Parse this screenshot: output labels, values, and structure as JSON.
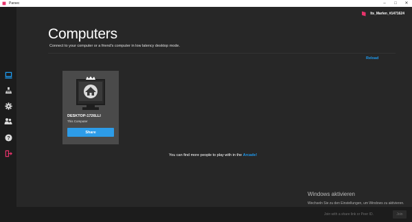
{
  "window": {
    "title": "Parsec"
  },
  "colors": {
    "accent": "#1e9bf0",
    "brand": "#e8336b",
    "sidebar": "#1c1c1c",
    "background": "#272727",
    "card": "#4a4a4a"
  },
  "sidebar": {
    "items": [
      {
        "icon": "computer-icon",
        "active": true
      },
      {
        "icon": "arcade-icon",
        "active": false
      },
      {
        "icon": "gear-icon",
        "active": false
      },
      {
        "icon": "friends-icon",
        "active": false
      },
      {
        "icon": "help-icon",
        "active": false
      },
      {
        "icon": "logout-icon",
        "active": false
      }
    ]
  },
  "header": {
    "username": "Its_Marlen_#1471624"
  },
  "main": {
    "title": "Computers",
    "subtitle": "Connect to your computer or a friend's computer in low latency desktop mode.",
    "reload_label": "Reload",
    "computer": {
      "name": "DESKTOP-1726LLI",
      "status": "This Computer",
      "share_label": "Share"
    },
    "arcade_note_prefix": "You can find more people to play with in the ",
    "arcade_link_label": "Arcade!"
  },
  "watermark": {
    "title": "Windows aktivieren",
    "subtitle": "Wechseln Sie zu den Einstellungen, um Windows zu aktivieren."
  },
  "footer": {
    "join_placeholder": "Join with a share link or Peer ID.",
    "join_label": "Join"
  }
}
